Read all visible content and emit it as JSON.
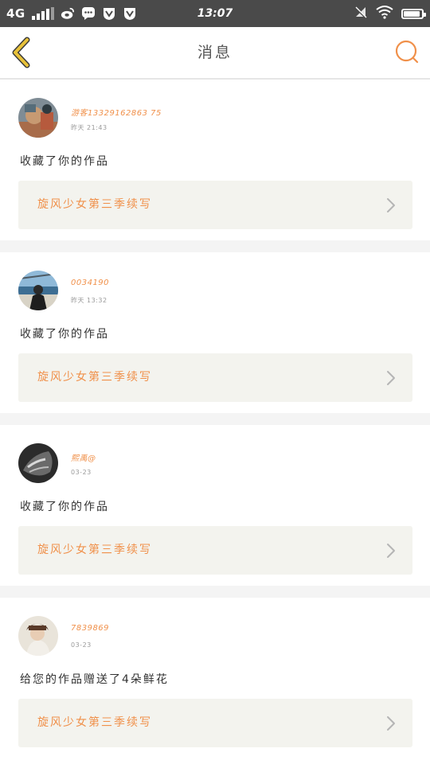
{
  "status_bar": {
    "network": "4G",
    "signal_bars": 4,
    "app_icons": [
      "weibo-icon",
      "chat-bubble-icon",
      "vee-icon",
      "vee-icon"
    ],
    "time": "13:07",
    "right_icons": [
      "mute-icon",
      "wifi-icon",
      "battery-icon"
    ],
    "battery_level": 0.9
  },
  "header": {
    "title": "消息",
    "back_icon": "chevron-left-icon",
    "search_icon": "search-icon",
    "accent_color": "#f0904a",
    "back_color": "#e8c23a"
  },
  "messages": [
    {
      "username": "游客13329162863 75",
      "time": "昨天 21:43",
      "action": "收藏了你的作品",
      "work_title": "旋风少女第三季续写"
    },
    {
      "username": "0034190",
      "time": "昨天 13:32",
      "action": "收藏了你的作品",
      "work_title": "旋风少女第三季续写"
    },
    {
      "username": "熙禹@",
      "time": "03-23",
      "action": "收藏了你的作品",
      "work_title": "旋风少女第三季续写"
    },
    {
      "username": "7839869",
      "time": "03-23",
      "action": "给您的作品赠送了4朵鲜花",
      "work_title": "旋风少女第三季续写"
    }
  ]
}
